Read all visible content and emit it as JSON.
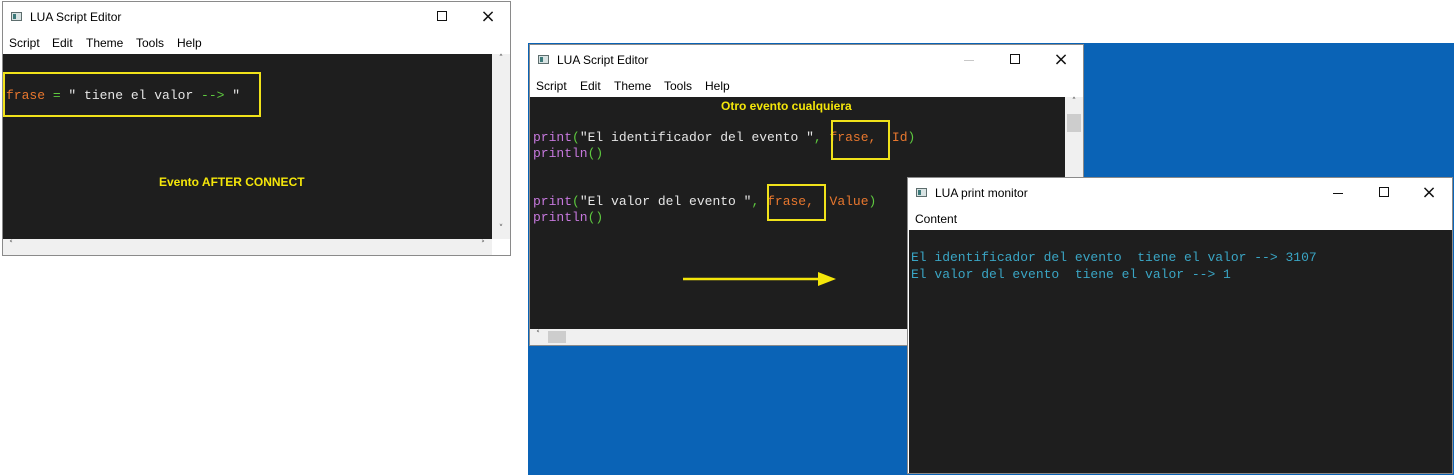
{
  "windows": {
    "editor_left": {
      "title": "LUA Script Editor",
      "menu": [
        "Script",
        "Edit",
        "Theme",
        "Tools",
        "Help"
      ],
      "code": {
        "var": "frase",
        "op": " = ",
        "str": "\" tiene el valor ",
        "arrow": "-->",
        "end": " \""
      },
      "annotation": "Evento AFTER CONNECT"
    },
    "editor_right": {
      "title": "LUA Script Editor",
      "menu": [
        "Script",
        "Edit",
        "Theme",
        "Tools",
        "Help"
      ],
      "annotation": "Otro evento cualquiera",
      "lines": [
        {
          "fn": "print",
          "open": "(",
          "str": "\"El identificador del evento \"",
          "comma": ",",
          "var": "frase,",
          "param": "Id",
          "close": ")"
        },
        {
          "fn": "println",
          "parens": "()"
        },
        {
          "fn": "print",
          "open": "(",
          "str": "\"El valor del evento \"",
          "comma": ",",
          "var": "frase,",
          "param": "Value",
          "close": ")"
        },
        {
          "fn": "println",
          "parens": "()"
        }
      ]
    },
    "monitor": {
      "title": "LUA print monitor",
      "menu": [
        "Content"
      ],
      "output": [
        "El identificador del evento  tiene el valor --> 3107",
        "El valor del evento  tiene el valor --> 1"
      ]
    }
  },
  "icons": {
    "close": "×",
    "up": "˄",
    "down": "˅",
    "left": "˂",
    "right": "˃"
  },
  "colors": {
    "editor_bg": "#1e1e1e",
    "desktop": "#0a63b6",
    "highlight": "#f0e21a",
    "keyword": "#c678dd",
    "variable": "#e8772e",
    "string_punct": "#5ec93f",
    "monitor_text": "#3aa5c4"
  }
}
